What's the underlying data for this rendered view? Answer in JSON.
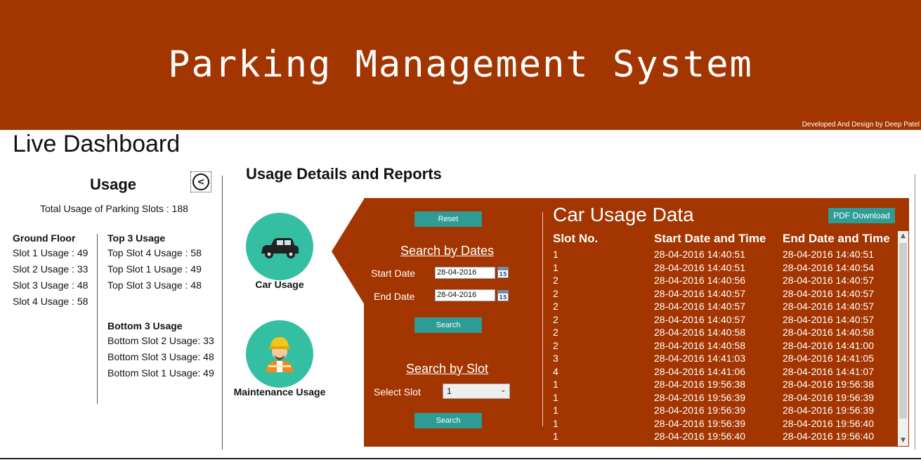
{
  "header": {
    "title": "Parking Management System",
    "credit": "Developed And Design by Deep Patel"
  },
  "dashboard_title": "Live Dashboard",
  "usage": {
    "title": "Usage",
    "total": "Total Usage of Parking Slots : 188",
    "ground_floor": {
      "heading": "Ground Floor",
      "items": [
        "Slot 1 Usage : 49",
        "Slot 2 Usage : 33",
        "Slot 3 Usage : 48",
        "Slot 4 Usage : 58"
      ]
    },
    "top3": {
      "heading": "Top 3 Usage",
      "items": [
        "Top Slot 4 Usage : 58",
        "Top Slot 1 Usage : 49",
        "Top Slot 3 Usage : 48"
      ]
    },
    "bottom3": {
      "heading": "Bottom 3 Usage",
      "items": [
        "Bottom Slot 2 Usage: 33",
        "Bottom Slot 3 Usage: 48",
        "Bottom Slot 1 Usage: 49"
      ]
    }
  },
  "reports": {
    "title": "Usage Details and Reports",
    "car_usage_label": "Car Usage",
    "maintenance_label": "Maintenance Usage"
  },
  "search": {
    "reset_label": "Reset",
    "by_dates_heading": "Search by Dates",
    "start_label": "Start Date",
    "start_value": "28-04-2016",
    "end_label": "End Date",
    "end_value": "28-04-2016",
    "calendar_day": "15",
    "search_label": "Search",
    "by_slot_heading": "Search by Slot",
    "select_label": "Select Slot",
    "select_value": "1"
  },
  "table": {
    "title": "Car Usage Data",
    "pdf_label": "PDF Download",
    "columns": [
      "Slot No.",
      "Start Date and Time",
      "End Date and Time"
    ],
    "rows": [
      [
        "1",
        "28-04-2016 14:40:51",
        "28-04-2016 14:40:51"
      ],
      [
        "1",
        "28-04-2016 14:40:51",
        "28-04-2016 14:40:54"
      ],
      [
        "2",
        "28-04-2016 14:40:56",
        "28-04-2016 14:40:57"
      ],
      [
        "2",
        "28-04-2016 14:40:57",
        "28-04-2016 14:40:57"
      ],
      [
        "2",
        "28-04-2016 14:40:57",
        "28-04-2016 14:40:57"
      ],
      [
        "2",
        "28-04-2016 14:40:57",
        "28-04-2016 14:40:57"
      ],
      [
        "2",
        "28-04-2016 14:40:58",
        "28-04-2016 14:40:58"
      ],
      [
        "2",
        "28-04-2016 14:40:58",
        "28-04-2016 14:41:00"
      ],
      [
        "3",
        "28-04-2016 14:41:03",
        "28-04-2016 14:41:05"
      ],
      [
        "4",
        "28-04-2016 14:41:06",
        "28-04-2016 14:41:07"
      ],
      [
        "1",
        "28-04-2016 19:56:38",
        "28-04-2016 19:56:38"
      ],
      [
        "1",
        "28-04-2016 19:56:39",
        "28-04-2016 19:56:39"
      ],
      [
        "1",
        "28-04-2016 19:56:39",
        "28-04-2016 19:56:39"
      ],
      [
        "1",
        "28-04-2016 19:56:39",
        "28-04-2016 19:56:40"
      ],
      [
        "1",
        "28-04-2016 19:56:40",
        "28-04-2016 19:56:40"
      ]
    ]
  },
  "colors": {
    "brand": "#a33500",
    "accent": "#34bfa3",
    "button": "#2e9b94"
  },
  "icons": {
    "back": "chevron-left-icon",
    "car": "car-icon",
    "worker": "worker-icon",
    "calendar": "calendar-icon"
  }
}
